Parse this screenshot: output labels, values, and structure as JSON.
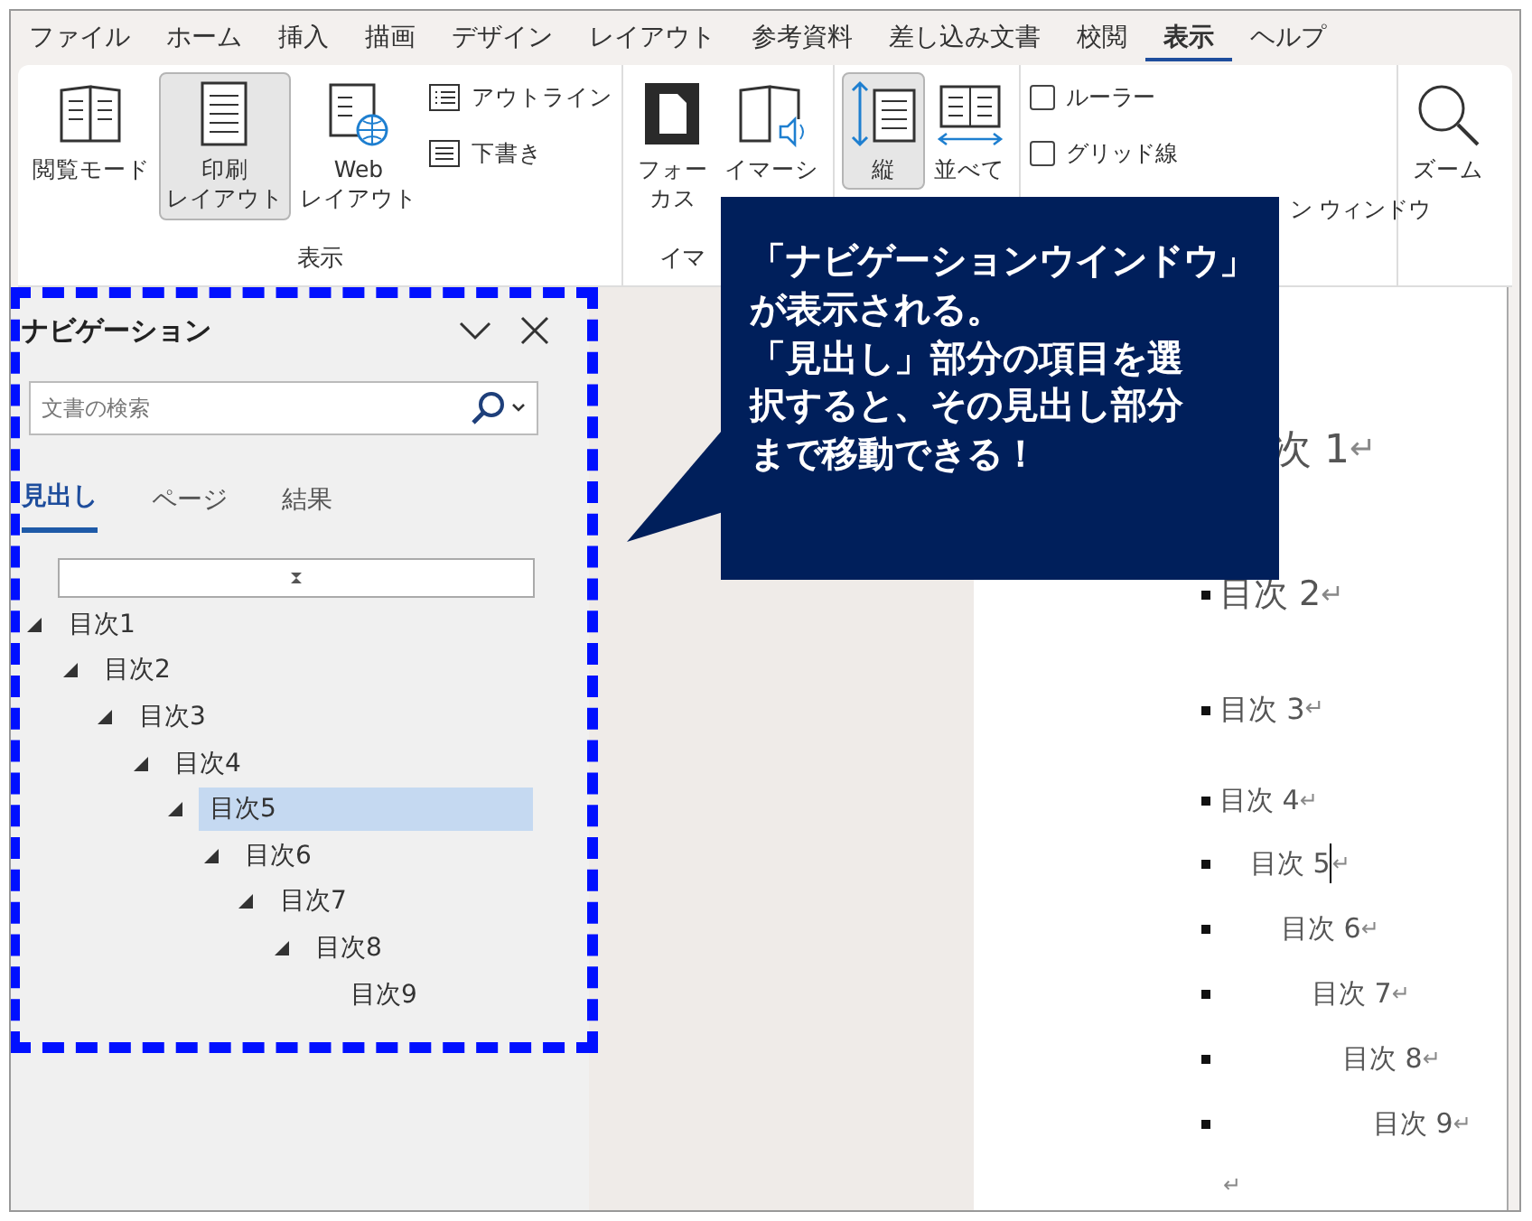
{
  "menu_tabs": [
    {
      "label": "ファイル",
      "selected": false
    },
    {
      "label": "ホーム",
      "selected": false
    },
    {
      "label": "挿入",
      "selected": false
    },
    {
      "label": "描画",
      "selected": false
    },
    {
      "label": "デザイン",
      "selected": false
    },
    {
      "label": "レイアウト",
      "selected": false
    },
    {
      "label": "参考資料",
      "selected": false
    },
    {
      "label": "差し込み文書",
      "selected": false
    },
    {
      "label": "校閲",
      "selected": false
    },
    {
      "label": "表示",
      "selected": true
    },
    {
      "label": "ヘルプ",
      "selected": false
    }
  ],
  "ribbon": {
    "groups": [
      {
        "label": "表示",
        "buttons": [
          {
            "kind": "large",
            "label_lines": [
              "閲覧モード"
            ],
            "selected": false
          },
          {
            "kind": "large",
            "label_lines": [
              "印刷",
              "レイアウト"
            ],
            "selected": true
          },
          {
            "kind": "large",
            "label_lines": [
              "Web",
              "レイアウト"
            ],
            "selected": false
          },
          {
            "kind": "small",
            "label": "アウトライン"
          },
          {
            "kind": "small",
            "label": "下書き"
          }
        ]
      },
      {
        "label": "イマ",
        "buttons": [
          {
            "kind": "large",
            "label_lines": [
              "フォー",
              "カス"
            ],
            "selected": false
          },
          {
            "kind": "large",
            "label_lines": [
              "イマーシ"
            ],
            "selected": false
          }
        ]
      },
      {
        "buttons": [
          {
            "kind": "large",
            "label_lines": [
              "縦"
            ],
            "selected": true
          },
          {
            "kind": "large",
            "label_lines": [
              "並べて"
            ],
            "selected": false
          }
        ]
      },
      {
        "buttons": [
          {
            "kind": "check",
            "label": "ルーラー",
            "checked": false
          },
          {
            "kind": "check",
            "label": "グリッド線",
            "checked": false
          },
          {
            "kind": "text",
            "label": "ン ウィンドウ"
          }
        ]
      },
      {
        "buttons": [
          {
            "kind": "large",
            "label_lines": [
              "ズーム"
            ],
            "selected": false
          }
        ]
      }
    ]
  },
  "navigation": {
    "title": "ナビゲーション",
    "search": {
      "placeholder": "文書の検索"
    },
    "tabs": [
      {
        "label": "見出し",
        "selected": true
      },
      {
        "label": "ページ",
        "selected": false
      },
      {
        "label": "結果",
        "selected": false
      }
    ],
    "tree": [
      {
        "label": "目次1",
        "expanded": true,
        "selected": false,
        "children": [
          {
            "label": "目次2",
            "expanded": true,
            "selected": false,
            "children": [
              {
                "label": "目次3",
                "expanded": true,
                "selected": false,
                "children": [
                  {
                    "label": "目次4",
                    "expanded": true,
                    "selected": false,
                    "children": [
                      {
                        "label": "目次5",
                        "expanded": true,
                        "selected": true,
                        "children": [
                          {
                            "label": "目次6",
                            "expanded": true,
                            "selected": false,
                            "children": [
                              {
                                "label": "目次7",
                                "expanded": true,
                                "selected": false,
                                "children": [
                                  {
                                    "label": "目次8",
                                    "expanded": true,
                                    "selected": false,
                                    "children": [
                                      {
                                        "label": "目次9",
                                        "selected": false
                                      }
                                    ]
                                  }
                                ]
                              }
                            ]
                          }
                        ]
                      }
                    ]
                  }
                ]
              }
            ]
          }
        ]
      }
    ]
  },
  "document": {
    "headings": [
      {
        "text": "次 1",
        "mark": "↵",
        "bullet": false
      },
      {
        "text": "目次 2",
        "mark": "↵",
        "bullet": true
      },
      {
        "text": "目次 3",
        "mark": "↵",
        "bullet": true
      },
      {
        "text": "目次 4",
        "mark": "↵",
        "bullet": true
      },
      {
        "text": "目次 5",
        "mark": "↵",
        "bullet": true,
        "cursor": true
      },
      {
        "text": "目次 6",
        "mark": "↵",
        "bullet": true
      },
      {
        "text": "目次 7",
        "mark": "↵",
        "bullet": true
      },
      {
        "text": "目次 8",
        "mark": "↵",
        "bullet": true
      },
      {
        "text": "目次 9",
        "mark": "↵",
        "bullet": true
      }
    ],
    "end_mark": "↵"
  },
  "callout": {
    "lines": [
      "「ナビゲーションウインドウ」",
      "が表示される。",
      "「見出し」部分の項目を選",
      "択すると、その見出し部分",
      "まで移動できる！"
    ]
  }
}
